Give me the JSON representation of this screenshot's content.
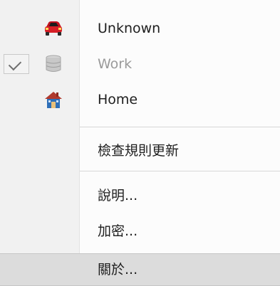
{
  "menu": {
    "items": [
      {
        "label": "Unknown",
        "icon": "car-icon",
        "checked": false,
        "disabled": false
      },
      {
        "label": "Work",
        "icon": "database-icon",
        "checked": true,
        "disabled": true
      },
      {
        "label": "Home",
        "icon": "house-icon",
        "checked": false,
        "disabled": false
      },
      {
        "label": "檢查規則更新"
      },
      {
        "label": "說明..."
      },
      {
        "label": "加密..."
      },
      {
        "label": "關於...",
        "highlighted": true
      }
    ]
  }
}
